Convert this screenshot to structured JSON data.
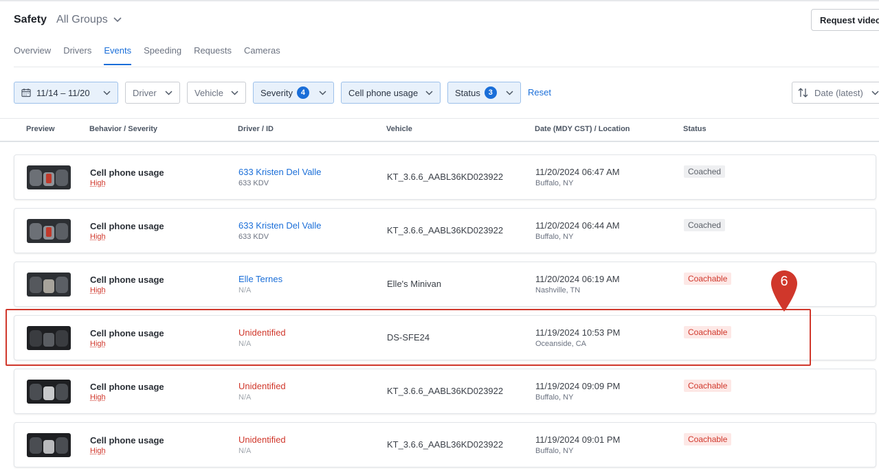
{
  "header": {
    "title": "Safety",
    "group": "All Groups",
    "request_video": "Request video"
  },
  "tabs": [
    "Overview",
    "Drivers",
    "Events",
    "Speeding",
    "Requests",
    "Cameras"
  ],
  "active_tab": "Events",
  "filters": {
    "date": "11/14 – 11/20",
    "driver": "Driver",
    "vehicle": "Vehicle",
    "severity": "Severity",
    "severity_count": "4",
    "behavior": "Cell phone usage",
    "status": "Status",
    "status_count": "3",
    "reset": "Reset",
    "sort": "Date (latest)"
  },
  "columns": [
    "Preview",
    "Behavior / Severity",
    "Driver / ID",
    "Vehicle",
    "Date (MDY CST) / Location",
    "Status"
  ],
  "rows": [
    {
      "behavior": "Cell phone usage",
      "severity": "High",
      "driver": "633 Kristen Del Valle",
      "driver_id": "633 KDV",
      "vehicle": "KT_3.6.6_AABL36KD023922",
      "date": "11/20/2024 06:47 AM",
      "location": "Buffalo, NY",
      "status": "Coached"
    },
    {
      "behavior": "Cell phone usage",
      "severity": "High",
      "driver": "633 Kristen Del Valle",
      "driver_id": "633 KDV",
      "vehicle": "KT_3.6.6_AABL36KD023922",
      "date": "11/20/2024 06:44 AM",
      "location": "Buffalo, NY",
      "status": "Coached"
    },
    {
      "behavior": "Cell phone usage",
      "severity": "High",
      "driver": "Elle Ternes",
      "driver_id": "N/A",
      "vehicle": "Elle's Minivan",
      "date": "11/20/2024 06:19 AM",
      "location": "Nashville, TN",
      "status": "Coachable"
    },
    {
      "behavior": "Cell phone usage",
      "severity": "High",
      "driver": "Unidentified",
      "driver_id": "N/A",
      "vehicle": "DS-SFE24",
      "date": "11/19/2024 10:53 PM",
      "location": "Oceanside, CA",
      "status": "Coachable"
    },
    {
      "behavior": "Cell phone usage",
      "severity": "High",
      "driver": "Unidentified",
      "driver_id": "N/A",
      "vehicle": "KT_3.6.6_AABL36KD023922",
      "date": "11/19/2024 09:09 PM",
      "location": "Buffalo, NY",
      "status": "Coachable"
    },
    {
      "behavior": "Cell phone usage",
      "severity": "High",
      "driver": "Unidentified",
      "driver_id": "N/A",
      "vehicle": "KT_3.6.6_AABL36KD023922",
      "date": "11/19/2024 09:01 PM",
      "location": "Buffalo, NY",
      "status": "Coachable"
    }
  ],
  "annotation": {
    "label": "6"
  },
  "colors": {
    "accent": "#1a6ed8",
    "danger": "#d0372b",
    "coached_bg": "#eeeff1",
    "coachable_bg": "#fde8e6"
  }
}
